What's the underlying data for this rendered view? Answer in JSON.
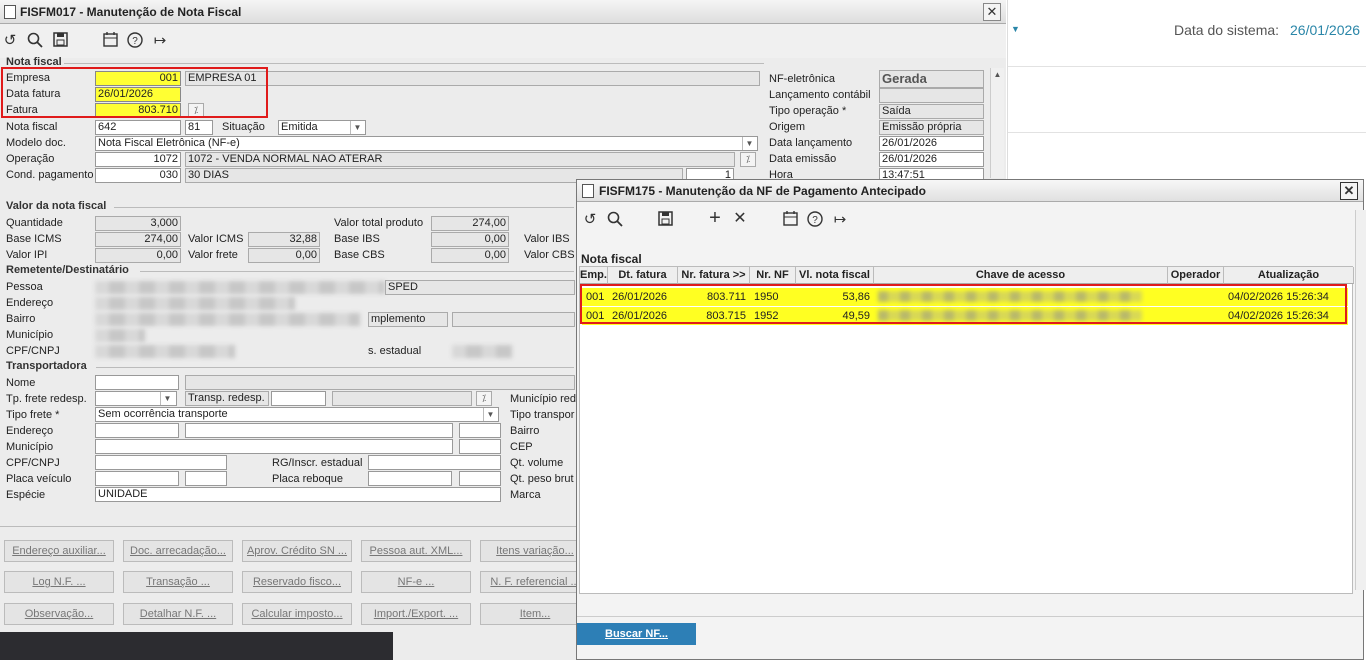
{
  "main_window": {
    "title": "FISFM017 - Manutenção de Nota Fiscal",
    "close": "✕",
    "sections": {
      "nota_fiscal": "Nota fiscal",
      "valor": "Valor da nota fiscal",
      "remetente": "Remetente/Destinatário",
      "transportadora": "Transportadora"
    },
    "labels": {
      "empresa": "Empresa",
      "data_fatura": "Data fatura",
      "fatura": "Fatura",
      "nota_fiscal": "Nota fiscal",
      "situacao": "Situação",
      "modelo_doc": "Modelo doc.",
      "operacao": "Operação",
      "cond_pagamento": "Cond. pagamento",
      "nf_eletronica": "NF-eletrônica",
      "lancamento_contabil": "Lançamento contábil",
      "tipo_operacao": "Tipo operação *",
      "origem": "Origem",
      "data_lancamento": "Data lançamento",
      "data_emissao": "Data emissão",
      "hora": "Hora"
    },
    "values": {
      "empresa_cod": "001",
      "empresa_nome": "EMPRESA 01",
      "data_fatura": "26/01/2026",
      "fatura": "803.710",
      "nota_fiscal": "642",
      "serie": "81",
      "situacao": "Emitida",
      "modelo_doc": "Nota Fiscal Eletrônica (NF-e)",
      "operacao_cod": "1072",
      "operacao_desc": "1072 - VENDA NORMAL NAO ATERAR",
      "cond_cod": "030",
      "cond_desc": "30 DIAS",
      "cond_extra": "1",
      "nf_eletronica": "Gerada",
      "tipo_operacao": "Saída",
      "origem": "Emissão própria",
      "data_lancamento": "26/01/2026",
      "data_emissao": "26/01/2026",
      "hora": "13:47:51"
    },
    "valor": {
      "quantidade_lbl": "Quantidade",
      "quantidade": "3,000",
      "base_icms_lbl": "Base ICMS",
      "base_icms": "274,00",
      "valor_icms_lbl": "Valor ICMS",
      "valor_icms": "32,88",
      "valor_ipi_lbl": "Valor IPI",
      "valor_ipi": "0,00",
      "valor_frete_lbl": "Valor frete",
      "valor_frete": "0,00",
      "total_produto_lbl": "Valor total produto",
      "total_produto": "274,00",
      "base_ibs_lbl": "Base IBS",
      "base_ibs": "0,00",
      "base_cbs_lbl": "Base CBS",
      "base_cbs": "0,00",
      "valor_ibs_lbl": "Valor IBS",
      "valor_cbs_lbl": "Valor CBS"
    },
    "remetente": {
      "pessoa": "Pessoa",
      "endereco": "Endereço",
      "bairro": "Bairro",
      "municipio": "Município",
      "cpf": "CPF/CNPJ",
      "sped": "SPED",
      "complemento": "mplemento",
      "insc_estadual": "s. estadual"
    },
    "transp": {
      "nome": "Nome",
      "tp_frete": "Tp. frete redesp.",
      "transp_redesp": "Transp. redesp.",
      "municipio_red": "Município red",
      "tipo_frete": "Tipo frete *",
      "tipo_frete_val": "Sem ocorrência transporte",
      "tipo_transp": "Tipo transpor",
      "endereco": "Endereço",
      "bairro": "Bairro",
      "municipio": "Município",
      "cep": "CEP",
      "cpf": "CPF/CNPJ",
      "rg": "RG/Inscr. estadual",
      "qt_volume": "Qt. volume",
      "placa": "Placa veículo",
      "placa_reboque": "Placa reboque",
      "qt_peso": "Qt. peso brut",
      "especie": "Espécie",
      "especie_val": "UNIDADE",
      "marca": "Marca"
    },
    "buttons": [
      [
        "Endereço auxiliar...",
        "Doc. arrecadação...",
        "Aprov. Crédito SN ...",
        "Pessoa aut. XML...",
        "Itens variação..."
      ],
      [
        "Log N.F. ...",
        "Transação ...",
        "Reservado fisco...",
        "NF-e ...",
        "N. F. referencial ..."
      ],
      [
        "Observação...",
        "Detalhar N.F. ...",
        "Calcular imposto...",
        "Import./Export. ...",
        "Item..."
      ]
    ]
  },
  "right_panel": {
    "label": "Data do sistema:",
    "date": "26/01/2026"
  },
  "dialog": {
    "title": "FISFM175 - Manutenção da NF de Pagamento Antecipado",
    "close": "✕",
    "section": "Nota fiscal",
    "columns": [
      "Emp.",
      "Dt. fatura",
      "Nr. fatura >>",
      "Nr. NF",
      "Vl. nota fiscal",
      "Chave de acesso",
      "Operador",
      "Atualização"
    ],
    "rows": [
      {
        "emp": "001",
        "dt": "26/01/2026",
        "nr_fatura": "803.711",
        "nr_nf": "1950",
        "valor": "53,86",
        "atualizacao": "04/02/2026 15:26:34"
      },
      {
        "emp": "001",
        "dt": "26/01/2026",
        "nr_fatura": "803.715",
        "nr_nf": "1952",
        "valor": "49,59",
        "atualizacao": "04/02/2026 15:26:34"
      }
    ],
    "buscar": "Buscar NF..."
  },
  "colors": {
    "highlight": "#ffff22",
    "red_box": "#e01b1b",
    "accent": "#2a86a8",
    "button_blue": "#2d7fb6"
  }
}
